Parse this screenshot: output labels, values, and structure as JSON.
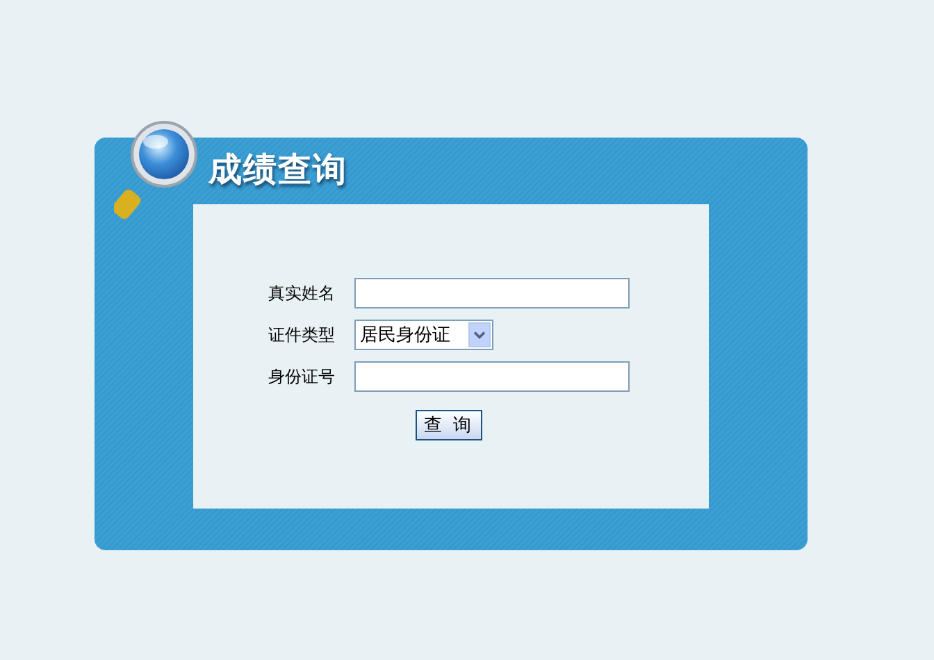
{
  "title": "成绩查询",
  "fields": [
    {
      "kind": "text",
      "label": "真实姓名"
    },
    {
      "kind": "select",
      "label": "证件类型",
      "value": "居民身份证"
    },
    {
      "kind": "text",
      "label": "身份证号"
    }
  ],
  "button": "查 询"
}
